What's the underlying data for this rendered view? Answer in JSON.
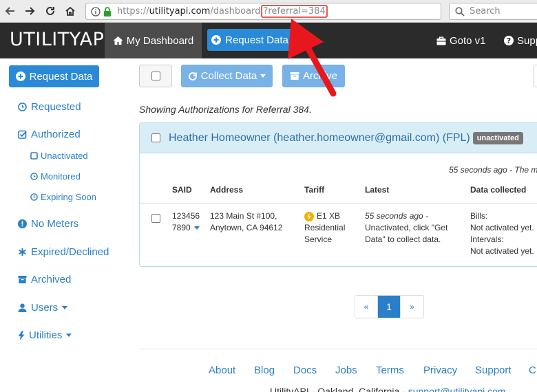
{
  "browser": {
    "url_scheme": "https://",
    "url_host": "utilityapi.com",
    "url_path": "/dashboard",
    "url_query": "?referral=384",
    "search_placeholder": "Search"
  },
  "navbar": {
    "brand": "UTILITYAPI",
    "my_dashboard": "My Dashboard",
    "request_data": "Request Data",
    "goto": "Goto v1",
    "support": "Support"
  },
  "sidebar": {
    "request_data": "Request Data",
    "requested": "Requested",
    "authorized": "Authorized",
    "unactivated": "Unactivated",
    "monitored": "Monitored",
    "expiring_soon": "Expiring Soon",
    "no_meters": "No Meters",
    "expired_declined": "Expired/Declined",
    "archived": "Archived",
    "users": "Users",
    "utilities": "Utilities"
  },
  "toolbar": {
    "collect_data": "Collect Data",
    "archive": "Archive"
  },
  "showing": "Showing Authorizations for Referral 384.",
  "panel": {
    "title": "Heather Homeowner (heather.homeowner@gmail.com) (FPL)",
    "badge": "unactivated",
    "ago": "55 seconds ago - The m",
    "columns": {
      "said": "SAID",
      "address": "Address",
      "tariff": "Tariff",
      "latest": "Latest",
      "data_collected": "Data collected"
    },
    "row": {
      "said_1": "123456",
      "said_2": "7890",
      "address_1": "123 Main St #100,",
      "address_2": "Anytown, CA 94612",
      "tariff_1": "E1 XB",
      "tariff_2": "Residential",
      "tariff_3": "Service",
      "latest_ago": "55 seconds ago",
      "latest_1": " -",
      "latest_2": "Unactivated, click \"Get",
      "latest_3": "Data\" to collect data.",
      "bills_label": "Bills:",
      "bills_value": "Not activated yet.",
      "intervals_label": "Intervals:",
      "intervals_value": "Not activated yet."
    }
  },
  "pagination": {
    "prev": "«",
    "current": "1",
    "next": "»"
  },
  "footer": {
    "links": [
      "About",
      "Blog",
      "Docs",
      "Jobs",
      "Terms",
      "Privacy",
      "Support",
      "C"
    ],
    "text": "UtilityAPI - Oakland, California - ",
    "email": "support@utilityapi.com"
  },
  "colors": {
    "primary": "#2a8ad8",
    "navbar": "#2b2b2b",
    "link": "#2a7fc9",
    "annotation": "#e8171e"
  }
}
